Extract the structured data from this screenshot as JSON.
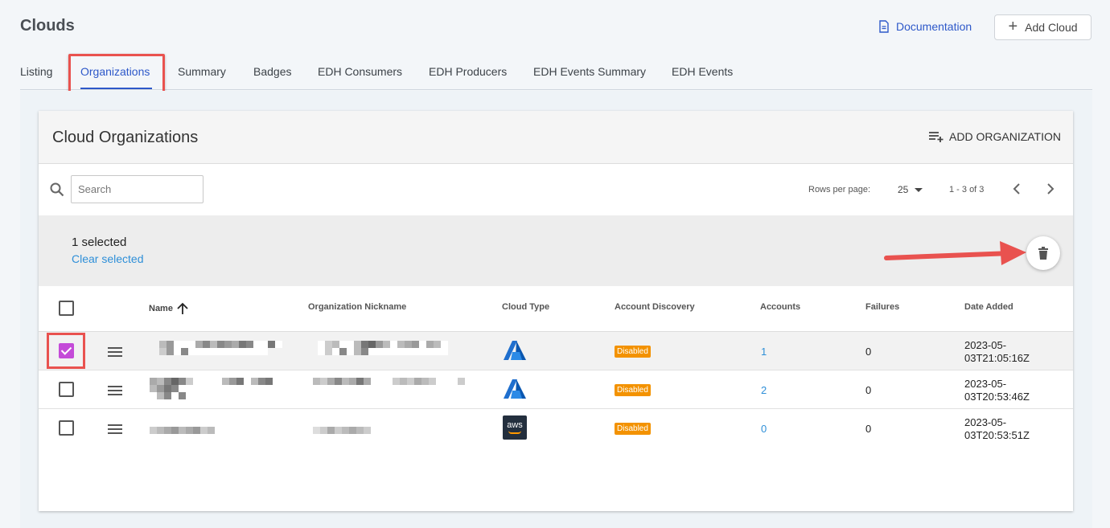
{
  "page": {
    "title": "Clouds",
    "documentation_label": "Documentation",
    "add_cloud_label": "Add Cloud"
  },
  "tabs": [
    {
      "label": "Listing",
      "active": false
    },
    {
      "label": "Organizations",
      "active": true
    },
    {
      "label": "Summary",
      "active": false
    },
    {
      "label": "Badges",
      "active": false
    },
    {
      "label": "EDH Consumers",
      "active": false
    },
    {
      "label": "EDH Producers",
      "active": false
    },
    {
      "label": "EDH Events Summary",
      "active": false
    },
    {
      "label": "EDH Events",
      "active": false
    }
  ],
  "card": {
    "title": "Cloud Organizations",
    "add_organization_label": "ADD ORGANIZATION"
  },
  "toolbar": {
    "search_placeholder": "Search",
    "rows_per_page_label": "Rows per page:",
    "rows_per_page_value": "25",
    "page_range": "1 - 3 of 3"
  },
  "selection": {
    "count_text": "1 selected",
    "clear_label": "Clear selected"
  },
  "table": {
    "columns": [
      "Name",
      "Organization Nickname",
      "Cloud Type",
      "Account Discovery",
      "Accounts",
      "Failures",
      "Date Added"
    ],
    "sort_column": "Name",
    "rows": [
      {
        "selected": true,
        "cloud_type": "azure",
        "account_discovery": "Disabled",
        "accounts": "1",
        "failures": "0",
        "date_line1": "2023-05-",
        "date_line2": "03T21:05:16Z"
      },
      {
        "selected": false,
        "cloud_type": "azure",
        "account_discovery": "Disabled",
        "accounts": "2",
        "failures": "0",
        "date_line1": "2023-05-",
        "date_line2": "03T20:53:46Z"
      },
      {
        "selected": false,
        "cloud_type": "aws",
        "account_discovery": "Disabled",
        "accounts": "0",
        "failures": "0",
        "date_line1": "2023-05-",
        "date_line2": "03T20:53:51Z"
      }
    ]
  },
  "icons": {
    "aws_text": "aws"
  },
  "colors": {
    "accent_blue": "#2d58c9",
    "link_blue": "#2e8fd8",
    "badge_orange": "#f39200",
    "checkbox_purple": "#c44bd8",
    "annotation_red": "#e9524f"
  }
}
